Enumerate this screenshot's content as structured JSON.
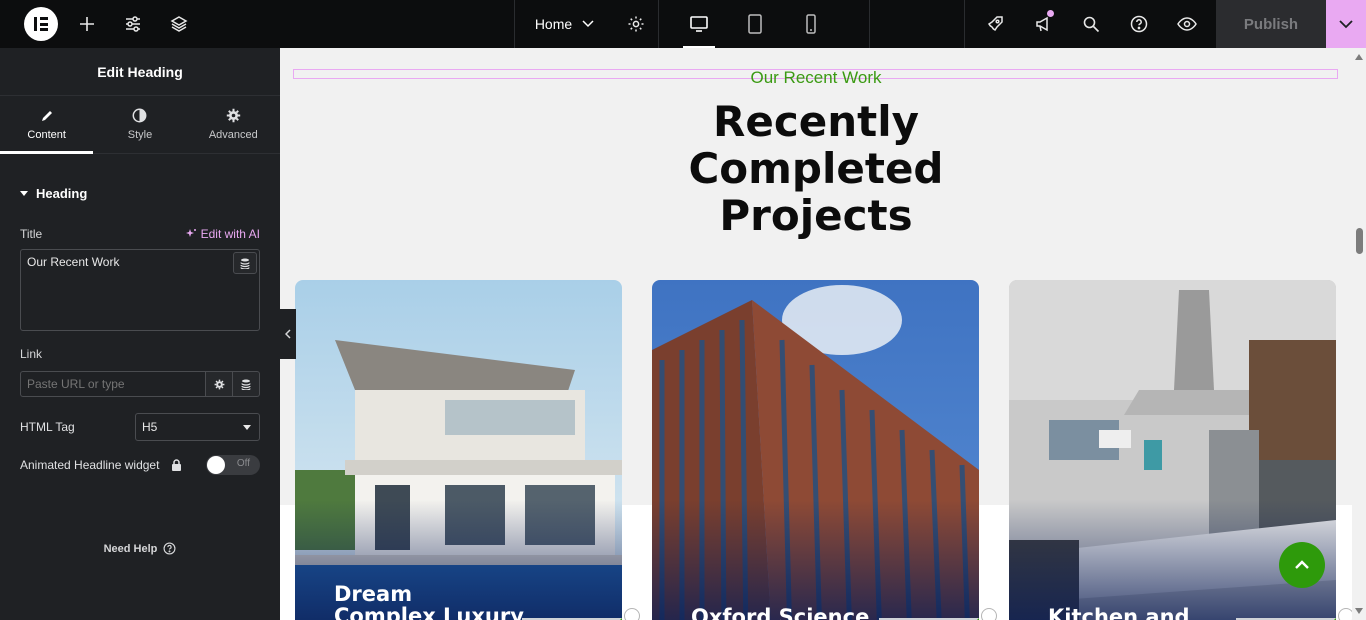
{
  "topbar": {
    "page_name": "Home",
    "publish_label": "Publish"
  },
  "sidebar": {
    "header_title": "Edit Heading",
    "tabs": [
      {
        "label": "Content",
        "active": true
      },
      {
        "label": "Style",
        "active": false
      },
      {
        "label": "Advanced",
        "active": false
      }
    ],
    "section_title": "Heading",
    "title_label": "Title",
    "ai_label": "Edit with AI",
    "title_value": "Our Recent Work",
    "link_label": "Link",
    "link_placeholder": "Paste URL or type",
    "html_tag_label": "HTML Tag",
    "html_tag_value": "H5",
    "animated_label": "Animated Headline widget",
    "animated_toggle": "Off",
    "need_help": "Need Help"
  },
  "canvas": {
    "eyebrow": "Our Recent Work",
    "headline_lines": [
      "Recently",
      "Completed",
      "Projects"
    ],
    "cards": [
      {
        "title_lines": [
          "Dream",
          "Complex Luxury"
        ]
      },
      {
        "title_lines": [
          "Oxford Science"
        ]
      },
      {
        "title_lines": [
          "Kitchen and"
        ]
      }
    ]
  },
  "colors": {
    "accent_green": "#3a9a12",
    "accent_pink": "#e9a9f2",
    "editor_dark": "#1f2124"
  }
}
